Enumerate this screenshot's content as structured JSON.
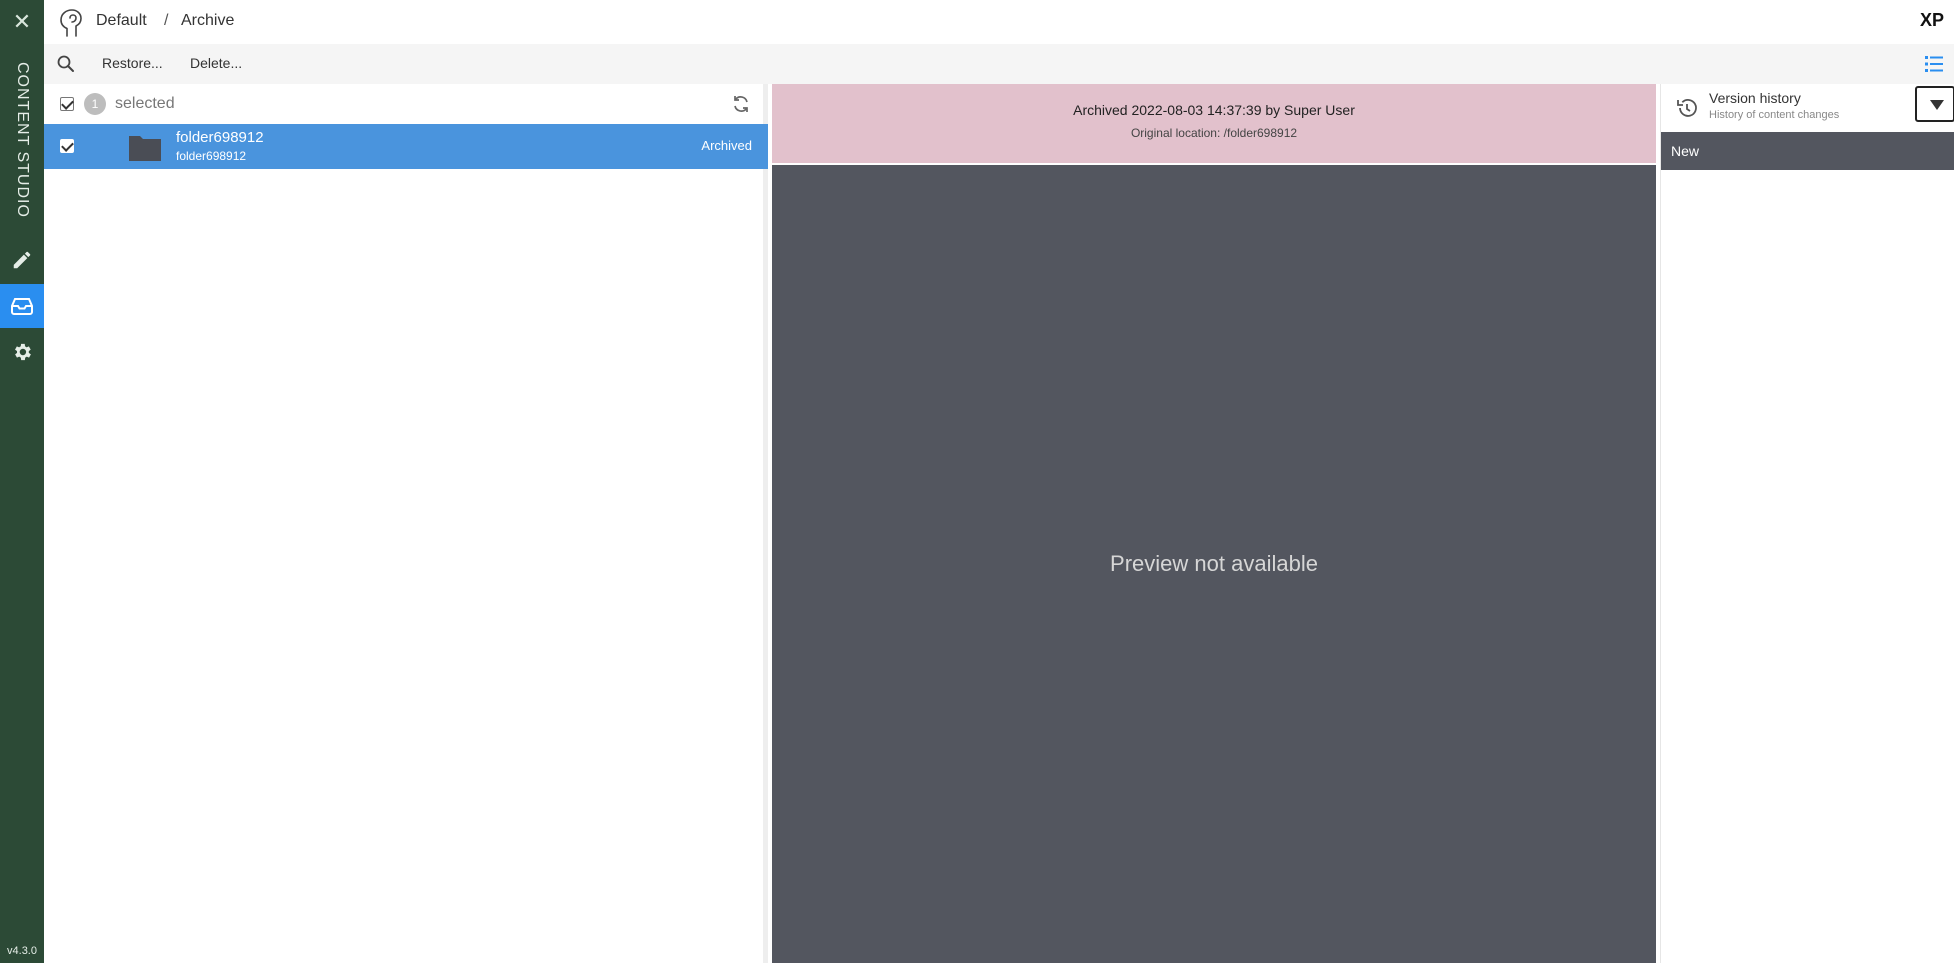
{
  "sidebar": {
    "close_icon": "close-icon",
    "title": "CONTENT STUDIO",
    "items": [
      {
        "icon": "pencil-icon"
      },
      {
        "icon": "archive-icon",
        "active": true
      },
      {
        "icon": "gear-icon"
      }
    ],
    "version": "v4.3.0",
    "background": "#2c4a36",
    "active_color": "#2a8ef0"
  },
  "header": {
    "breadcrumb": [
      "Default",
      "/",
      "Archive"
    ],
    "brand": "XP"
  },
  "toolbar": {
    "restore_label": "Restore...",
    "delete_label": "Delete..."
  },
  "grid": {
    "selected_count": "1",
    "selected_label": "selected",
    "rows": [
      {
        "name": "folder698912",
        "path": "folder698912",
        "status": "Archived",
        "selected": true
      }
    ],
    "row_selected_color": "#4a94dd"
  },
  "preview": {
    "archive_info": "Archived 2022-08-03 14:37:39 by Super User",
    "original_location": "Original location:  /folder698912",
    "message": "Preview not available",
    "info_bg": "#e2c1cc",
    "area_bg": "#53565f"
  },
  "context": {
    "title": "Version history",
    "subtitle": "History of content changes",
    "versions": [
      "New"
    ]
  }
}
